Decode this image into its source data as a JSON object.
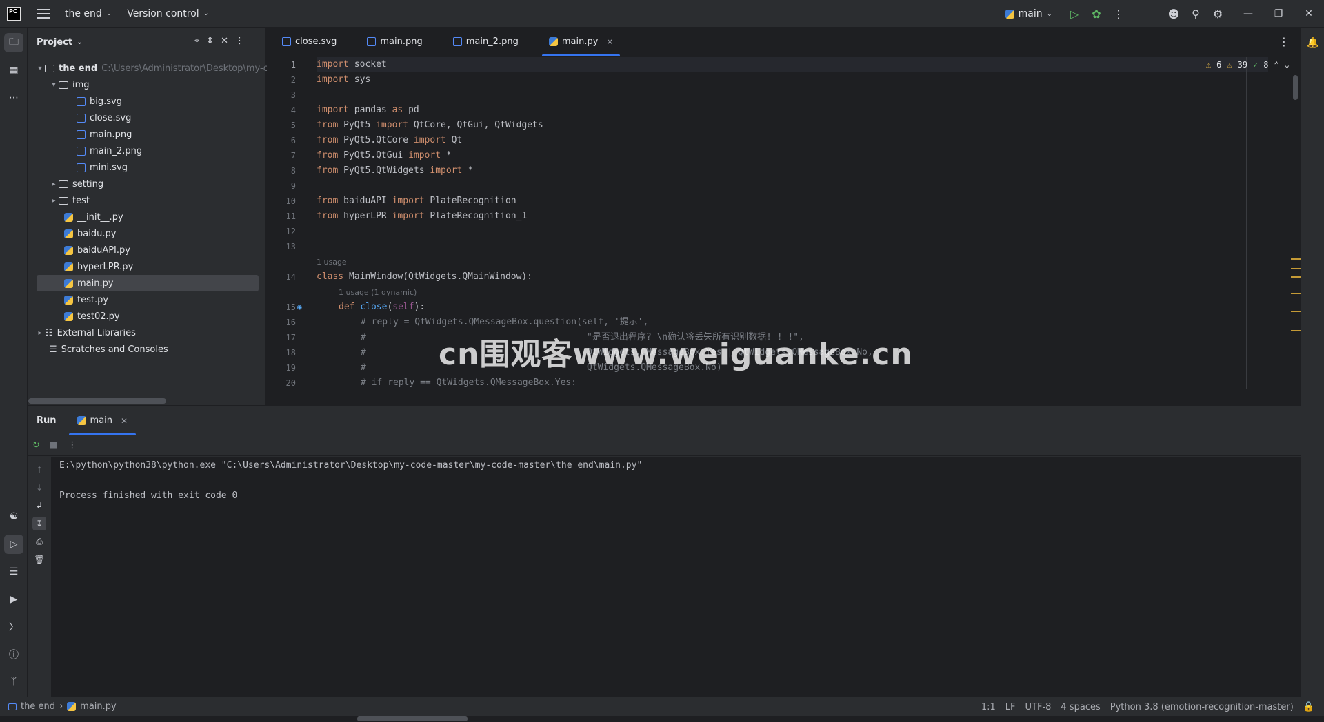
{
  "titlebar": {
    "project_name": "the end",
    "vcs_label": "Version control",
    "run_config": "main"
  },
  "tool_windows": {
    "project_title": "Project",
    "run_title": "Run",
    "run_tab": "main"
  },
  "project_tree": {
    "root_name": "the end",
    "root_path": "C:\\Users\\Administrator\\Desktop\\my-c",
    "img_folder": "img",
    "img_files": [
      "big.svg",
      "close.svg",
      "main.png",
      "main_2.png",
      "mini.svg"
    ],
    "folders": [
      "setting",
      "test"
    ],
    "py_files": [
      "__init__.py",
      "baidu.py",
      "baiduAPI.py",
      "hyperLPR.py",
      "main.py",
      "test.py",
      "test02.py"
    ],
    "external_libraries": "External Libraries",
    "scratches": "Scratches and Consoles"
  },
  "tabs": [
    "close.svg",
    "main.png",
    "main_2.png",
    "main.py"
  ],
  "inspections": {
    "warnings": "6",
    "weak_warnings": "39",
    "ok": "8"
  },
  "editor": {
    "line_numbers": [
      "1",
      "2",
      "3",
      "4",
      "5",
      "6",
      "7",
      "8",
      "9",
      "10",
      "11",
      "12",
      "13",
      "14",
      "15",
      "16",
      "17",
      "18",
      "19",
      "20"
    ],
    "hint_usage": "1 usage",
    "hint_usage_dynamic": "1 usage (1 dynamic)",
    "code": {
      "l1_kw": "import",
      "l1_rest": " socket",
      "l2_kw": "import",
      "l2_rest": " sys",
      "l4_kw": "import",
      "l4_mid": " pandas ",
      "l4_kw2": "as",
      "l4_rest": " pd",
      "l5_kw": "from",
      "l5_mid": " PyQt5 ",
      "l5_kw2": "import",
      "l5_rest": " QtCore, QtGui, QtWidgets",
      "l6_kw": "from",
      "l6_mid": " PyQt5.QtCore ",
      "l6_kw2": "import",
      "l6_rest": " Qt",
      "l7_kw": "from",
      "l7_mid": " PyQt5.QtGui ",
      "l7_kw2": "import",
      "l7_rest": " *",
      "l8_kw": "from",
      "l8_mid": " PyQt5.QtWidgets ",
      "l8_kw2": "import",
      "l8_rest": " *",
      "l10_kw": "from",
      "l10_mid": " baiduAPI ",
      "l10_kw2": "import",
      "l10_rest": " PlateRecognition",
      "l11_kw": "from",
      "l11_mid": " hyperLPR ",
      "l11_kw2": "import",
      "l11_rest": " PlateRecognition_1",
      "l14_kw": "class",
      "l14_rest": " MainWindow(QtWidgets.QMainWindow):",
      "l15_kw": "def",
      "l15_fn": " close",
      "l15_open": "(",
      "l15_self": "self",
      "l15_close": "):",
      "l16": "# reply = QtWidgets.QMessageBox.question(self, '提示',",
      "l17_hash": "#",
      "l17_text": "\"是否退出程序? \\n确认将丢失所有识别数据! ! !\",",
      "l18_hash": "#",
      "l18_text": "QtWidgets.QMessageBox.Yes | QtWidgets.QMessageBox.No,",
      "l19_hash": "#",
      "l19_text": "QtWidgets.QMessageBox.No)",
      "l20": "# if reply == QtWidgets.QMessageBox.Yes:"
    },
    "watermark": "cn围观客www.weiguanke.cn"
  },
  "console": {
    "command": "E:\\python\\python38\\python.exe \"C:\\Users\\Administrator\\Desktop\\my-code-master\\my-code-master\\the end\\main.py\"",
    "exit_message": "Process finished with exit code 0"
  },
  "statusbar": {
    "crumb_project": "the end",
    "crumb_file": "main.py",
    "position": "1:1",
    "line_sep": "LF",
    "encoding": "UTF-8",
    "indent": "4 spaces",
    "interpreter": "Python 3.8 (emotion-recognition-master)"
  },
  "colors": {
    "accent": "#3574f0",
    "keyword": "#cf8e6d",
    "comment": "#7a7e85",
    "function": "#56a8f5"
  },
  "icons": [
    "pycharm-logo",
    "hamburger-icon",
    "run-icon",
    "debug-icon",
    "more-icon",
    "add-user-icon",
    "search-icon",
    "gear-icon",
    "notifications-icon"
  ]
}
